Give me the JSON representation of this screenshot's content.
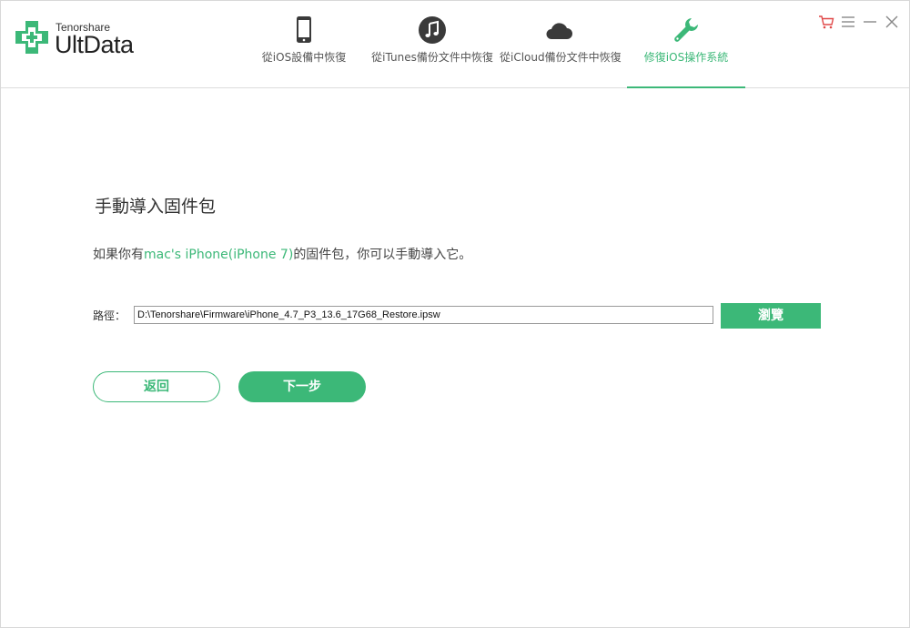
{
  "brand": {
    "company": "Tenorshare",
    "product": "UltData",
    "accent_color": "#3cb878"
  },
  "tabs": [
    {
      "label": "從iOS設備中恢復",
      "icon": "phone-icon",
      "active": false
    },
    {
      "label": "從iTunes備份文件中恢復",
      "icon": "music-note-icon",
      "active": false
    },
    {
      "label": "從iCloud備份文件中恢復",
      "icon": "cloud-icon",
      "active": false
    },
    {
      "label": "修復iOS操作系統",
      "icon": "wrench-icon",
      "active": true
    }
  ],
  "window_controls": [
    "cart-icon",
    "menu-icon",
    "minimize-icon",
    "close-icon"
  ],
  "main": {
    "title": "手動導入固件包",
    "desc_prefix": "如果你有",
    "desc_highlight": "mac's iPhone(iPhone 7)",
    "desc_suffix": "的固件包，你可以手動導入它。",
    "path_label": "路徑：",
    "path_value": "D:\\Tenorshare\\Firmware\\iPhone_4.7_P3_13.6_17G68_Restore.ipsw",
    "browse_label": "瀏覽",
    "back_label": "返回",
    "next_label": "下一步"
  }
}
